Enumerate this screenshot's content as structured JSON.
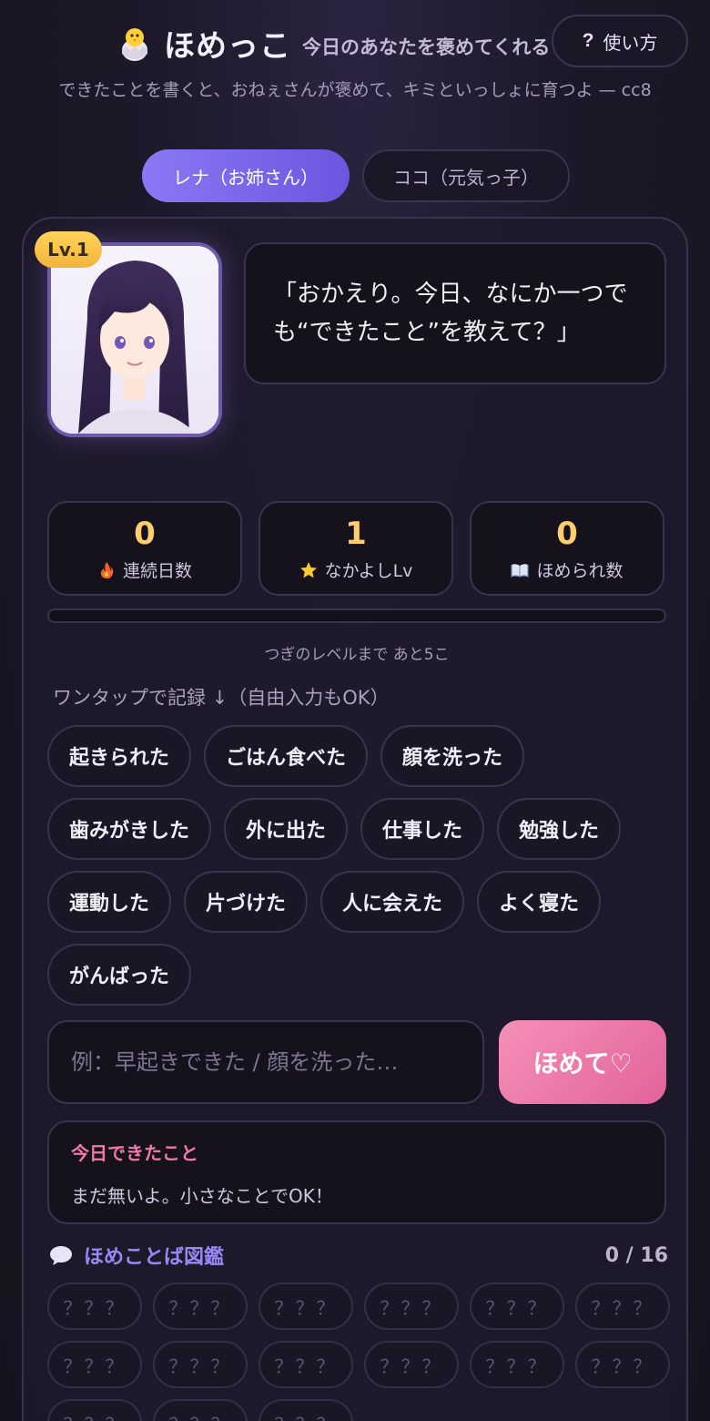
{
  "header": {
    "app_title": "ほめっこ",
    "tagline": "今日のあなたを褒めてくれる",
    "subtitle": "できたことを書くと、おねぇさんが褒めて、キミといっしょに育つよ — cc8",
    "help_label": "使い方",
    "help_icon": "?"
  },
  "tabs": [
    {
      "label": "レナ（お姉さん）",
      "active": true
    },
    {
      "label": "ココ（元気っ子）",
      "active": false
    }
  ],
  "character": {
    "level_badge": "Lv.1",
    "speech": "「おかえり。今日、なにか一つでも“できたこと”を教えて？」"
  },
  "stats": [
    {
      "value": "0",
      "label": "連続日数",
      "icon": "fire-icon"
    },
    {
      "value": "1",
      "label": "なかよしLv",
      "icon": "star-icon"
    },
    {
      "value": "0",
      "label": "ほめられ数",
      "icon": "book-icon"
    }
  ],
  "progress": {
    "fraction": 0,
    "text": "つぎのレベルまで あと5こ"
  },
  "quick": {
    "label": "ワンタップで記録 ↓（自由入力もOK）",
    "chips": [
      "起きられた",
      "ごはん食べた",
      "顔を洗った",
      "歯みがきした",
      "外に出た",
      "仕事した",
      "勉強した",
      "運動した",
      "片づけた",
      "人に会えた",
      "よく寝た",
      "がんばった"
    ]
  },
  "input": {
    "placeholder": "例：早起きできた / 顔を洗った…",
    "value": ""
  },
  "praise_button": "ほめて♡",
  "today": {
    "title": "今日できたこと",
    "body": "まだ無いよ。小さなことでOK！"
  },
  "dex": {
    "title": "ほめことば図鑑",
    "count": "0 / 16",
    "locked_label": "？？？",
    "visible_items": 15
  },
  "colors": {
    "accent": "#8a78f4",
    "pink": "#f279a8",
    "gold": "#ffd06a",
    "background": "#1c1828"
  }
}
